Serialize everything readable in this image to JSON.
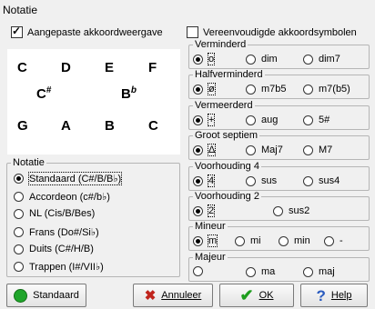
{
  "dialog": {
    "title": "Notatie"
  },
  "options": {
    "custom_chord_display": {
      "label": "Aangepaste akkoordweergave",
      "checked": true
    },
    "simplified_symbols": {
      "label": "Vereenvoudigde akkoordsymbolen",
      "checked": false
    }
  },
  "preview": {
    "chords": [
      {
        "root": "C",
        "acc": ""
      },
      {
        "root": "D",
        "acc": ""
      },
      {
        "root": "E",
        "acc": ""
      },
      {
        "root": "F",
        "acc": ""
      },
      {
        "root": "C",
        "acc": "#"
      },
      {
        "root": "B",
        "acc": "b"
      },
      {
        "root": "G",
        "acc": ""
      },
      {
        "root": "A",
        "acc": ""
      },
      {
        "root": "B",
        "acc": ""
      },
      {
        "root": "C",
        "acc": ""
      }
    ]
  },
  "notation": {
    "label": "Notatie",
    "selected": 0,
    "items": [
      "Standaard (C#/B/B♭)",
      "Accordeon (c#/b♭)",
      "NL (Cis/B/Bes)",
      "Frans (Do#/Si♭)",
      "Duits (C#/H/B)",
      "Trappen (I#/VII♭)"
    ]
  },
  "groups": [
    {
      "label": "Verminderd",
      "selected": 0,
      "options": [
        "o",
        "dim",
        "dim7"
      ]
    },
    {
      "label": "Halfverminderd",
      "selected": 0,
      "options": [
        "ø",
        "m7b5",
        "m7(b5)"
      ]
    },
    {
      "label": "Vermeerderd",
      "selected": 0,
      "options": [
        "+",
        "aug",
        "5#"
      ]
    },
    {
      "label": "Groot septiem",
      "selected": 0,
      "options": [
        "Δ",
        "Maj7",
        "M7"
      ]
    },
    {
      "label": "Voorhouding 4",
      "selected": 0,
      "options": [
        "4",
        "sus",
        "sus4"
      ]
    },
    {
      "label": "Voorhouding 2",
      "selected": 0,
      "options": [
        "2",
        "sus2"
      ]
    },
    {
      "label": "Mineur",
      "selected": 0,
      "options": [
        "m",
        "mi",
        "min",
        "-"
      ]
    },
    {
      "label": "Majeur",
      "selected": -1,
      "options": [
        "",
        "ma",
        "maj"
      ]
    }
  ],
  "buttons": {
    "standard": "Standaard",
    "cancel": "Annuleer",
    "ok": "OK",
    "help": "Help"
  },
  "colors": {
    "standard_icon": "#1fa52a",
    "cancel_icon": "#c0241c",
    "ok_icon": "#1f9e1f",
    "help_icon": "#2a5bbf"
  }
}
